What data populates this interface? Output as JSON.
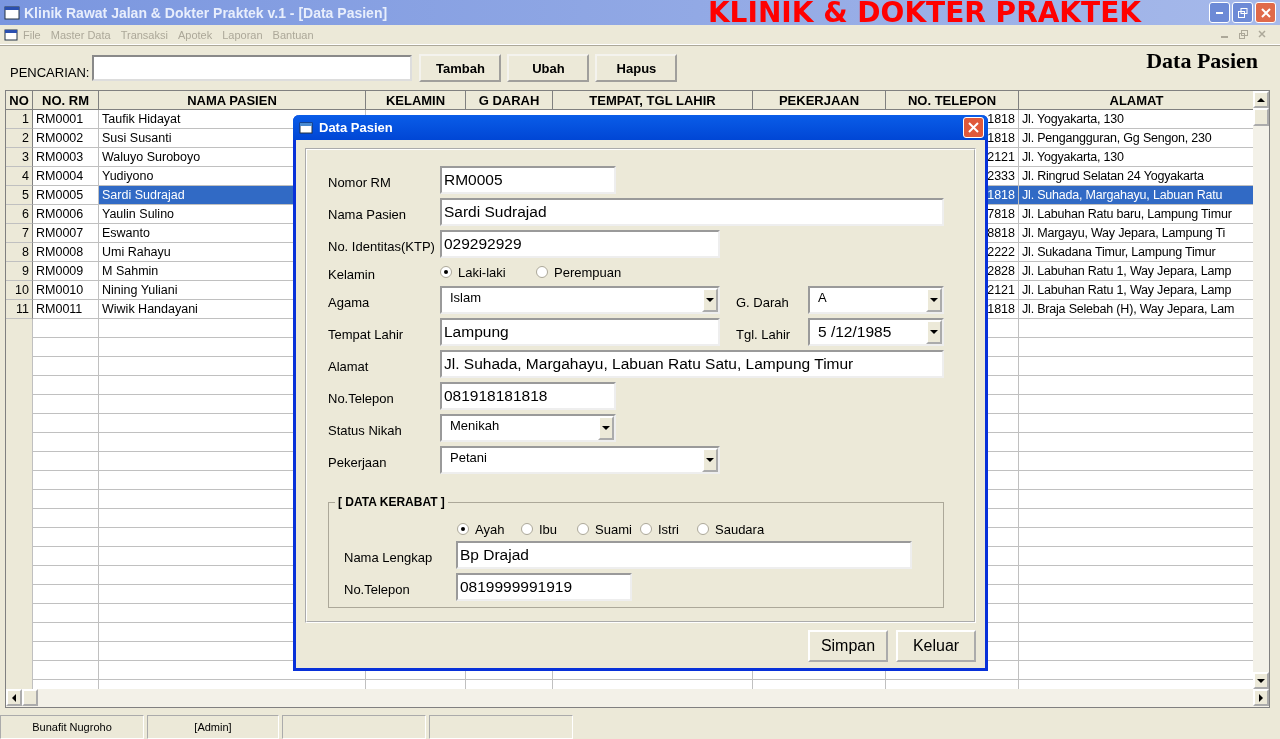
{
  "window": {
    "title": "Klinik Rawat Jalan & Dokter Praktek v.1 - [Data Pasien]",
    "banner": "KLINIK & DOKTER PRAKTEK"
  },
  "menu": [
    {
      "label": "File",
      "disabled": true
    },
    {
      "label": "Master Data",
      "disabled": true
    },
    {
      "label": "Transaksi",
      "disabled": true
    },
    {
      "label": "Apotek",
      "disabled": true
    },
    {
      "label": "Laporan",
      "disabled": true
    },
    {
      "label": "Bantuan",
      "disabled": true
    }
  ],
  "toolbar": {
    "search_label": "PENCARIAN:",
    "buttons": [
      "Tambah",
      "Ubah",
      "Hapus"
    ],
    "heading": "Data Pasien"
  },
  "table": {
    "columns": [
      "NO",
      "NO. RM",
      "NAMA PASIEN",
      "KELAMIN",
      "G DARAH",
      "TEMPAT, TGL LAHIR",
      "PEKERJAAN",
      "NO. TELEPON",
      "ALAMAT"
    ],
    "rows": [
      {
        "no": "1",
        "rm": "RM0001",
        "nama": "Taufik Hidayat",
        "telepon": "1818",
        "alamat": "Jl. Yogyakarta, 130",
        "selected": false
      },
      {
        "no": "2",
        "rm": "RM0002",
        "nama": "Susi Susanti",
        "telepon": "1818",
        "alamat": "Jl. Pengangguran, Gg Sengon, 230",
        "selected": false
      },
      {
        "no": "3",
        "rm": "RM0003",
        "nama": "Waluyo Suroboyo",
        "telepon": "2121",
        "alamat": "Jl. Yogyakarta, 130",
        "selected": false
      },
      {
        "no": "4",
        "rm": "RM0004",
        "nama": "Yudiyono",
        "telepon": "2333",
        "alamat": "Jl. Ringrud Selatan 24 Yogyakarta",
        "selected": false
      },
      {
        "no": "5",
        "rm": "RM0005",
        "nama": "Sardi Sudrajad",
        "telepon": "1818",
        "alamat": "Jl. Suhada, Margahayu, Labuan Ratu",
        "selected": true
      },
      {
        "no": "6",
        "rm": "RM0006",
        "nama": "Yaulin Sulino",
        "telepon": "7818",
        "alamat": "Jl. Labuhan Ratu baru, Lampung Timur",
        "selected": false
      },
      {
        "no": "7",
        "rm": "RM0007",
        "nama": "Eswanto",
        "telepon": "8818",
        "alamat": "Jl. Margayu, Way Jepara, Lampung Ti",
        "selected": false
      },
      {
        "no": "8",
        "rm": "RM0008",
        "nama": "Umi Rahayu",
        "telepon": "2222",
        "alamat": "Jl. Sukadana Timur, Lampung Timur",
        "selected": false
      },
      {
        "no": "9",
        "rm": "RM0009",
        "nama": "M Sahmin",
        "telepon": "2828",
        "alamat": "Jl. Labuhan Ratu 1, Way Jepara, Lamp",
        "selected": false
      },
      {
        "no": "10",
        "rm": "RM0010",
        "nama": "Nining Yuliani",
        "telepon": "2121",
        "alamat": "Jl. Labuhan Ratu 1, Way Jepara, Lamp",
        "selected": false
      },
      {
        "no": "11",
        "rm": "RM0011",
        "nama": "Wiwik Handayani",
        "telepon": "1818",
        "alamat": "Jl. Braja Selebah (H), Way Jepara, Lam",
        "selected": false
      }
    ]
  },
  "dialog": {
    "title": "Data Pasien",
    "nomor_rm": {
      "label": "Nomor RM",
      "value": "RM0005"
    },
    "nama_pasien": {
      "label": "Nama Pasien",
      "value": "Sardi Sudrajad"
    },
    "no_identitas": {
      "label": "No. Identitas(KTP)",
      "value": "029292929"
    },
    "kelamin": {
      "label": "Kelamin",
      "options": [
        {
          "label": "Laki-laki",
          "selected": true
        },
        {
          "label": "Perempuan",
          "selected": false
        }
      ]
    },
    "agama": {
      "label": "Agama",
      "value": "Islam"
    },
    "g_darah": {
      "label": "G. Darah",
      "value": "A"
    },
    "tempat_lahir": {
      "label": "Tempat Lahir",
      "value": "Lampung"
    },
    "tgl_lahir": {
      "label": "Tgl. Lahir",
      "value": "5 /12/1985"
    },
    "alamat": {
      "label": "Alamat",
      "value": "Jl. Suhada, Margahayu, Labuan Ratu Satu, Lampung Timur"
    },
    "no_telepon": {
      "label": "No.Telepon",
      "value": "081918181818"
    },
    "status_nikah": {
      "label": "Status Nikah",
      "value": "Menikah"
    },
    "pekerjaan": {
      "label": "Pekerjaan",
      "value": "Petani"
    },
    "kerabat": {
      "legend": "[ DATA KERABAT ]",
      "hubungan": [
        {
          "label": "Ayah",
          "selected": true
        },
        {
          "label": "Ibu",
          "selected": false
        },
        {
          "label": "Suami",
          "selected": false
        },
        {
          "label": "Istri",
          "selected": false
        },
        {
          "label": "Saudara",
          "selected": false
        }
      ],
      "nama_lengkap": {
        "label": "Nama Lengkap",
        "value": "Bp Drajad"
      },
      "no_telepon": {
        "label": "No.Telepon",
        "value": "0819999991919"
      }
    },
    "buttons": [
      "Simpan",
      "Keluar"
    ]
  },
  "status_bar": [
    "Bunafit Nugroho",
    "[Admin]"
  ]
}
